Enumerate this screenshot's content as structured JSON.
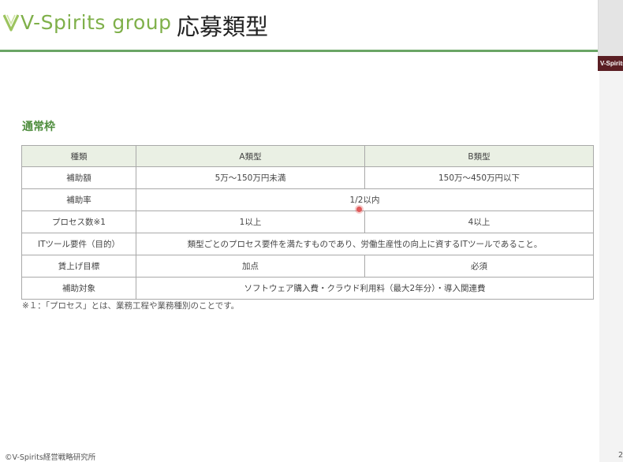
{
  "header": {
    "logo_text": "V-Spirits group",
    "title": "応募類型"
  },
  "side_panel": {
    "badge": "V-Spirits"
  },
  "section": {
    "heading": "通常枠"
  },
  "table": {
    "headers": [
      "種類",
      "A類型",
      "B類型"
    ],
    "rows": {
      "amount": {
        "label": "補助額",
        "a": "5万～150万円未満",
        "b": "150万～450万円以下"
      },
      "rate": {
        "label": "補助率",
        "value": "1/2以内"
      },
      "process": {
        "label": "プロセス数※1",
        "a": "1以上",
        "b": "4以上"
      },
      "it_tool": {
        "label": "ITツール要件（目的）",
        "value": "類型ごとのプロセス要件を満たすものであり、労働生産性の向上に資するITツールであること。"
      },
      "wage": {
        "label": "賃上げ目標",
        "a": "加点",
        "b": "必須"
      },
      "target": {
        "label": "補助対象",
        "value": "ソフトウェア購入費・クラウド利用料（最大2年分）・導入関連費"
      }
    }
  },
  "footnote": "※１：「プロセス」とは、業務工程や業務種別のことです。",
  "footer": {
    "copyright": "©V-Spirits経営戦略研究所",
    "page_number": "2"
  },
  "colors": {
    "accent_green": "#6aa565",
    "logo_green": "#7fb04a",
    "heading_green": "#4e8d3d",
    "table_header_bg": "#eaf0e4"
  }
}
